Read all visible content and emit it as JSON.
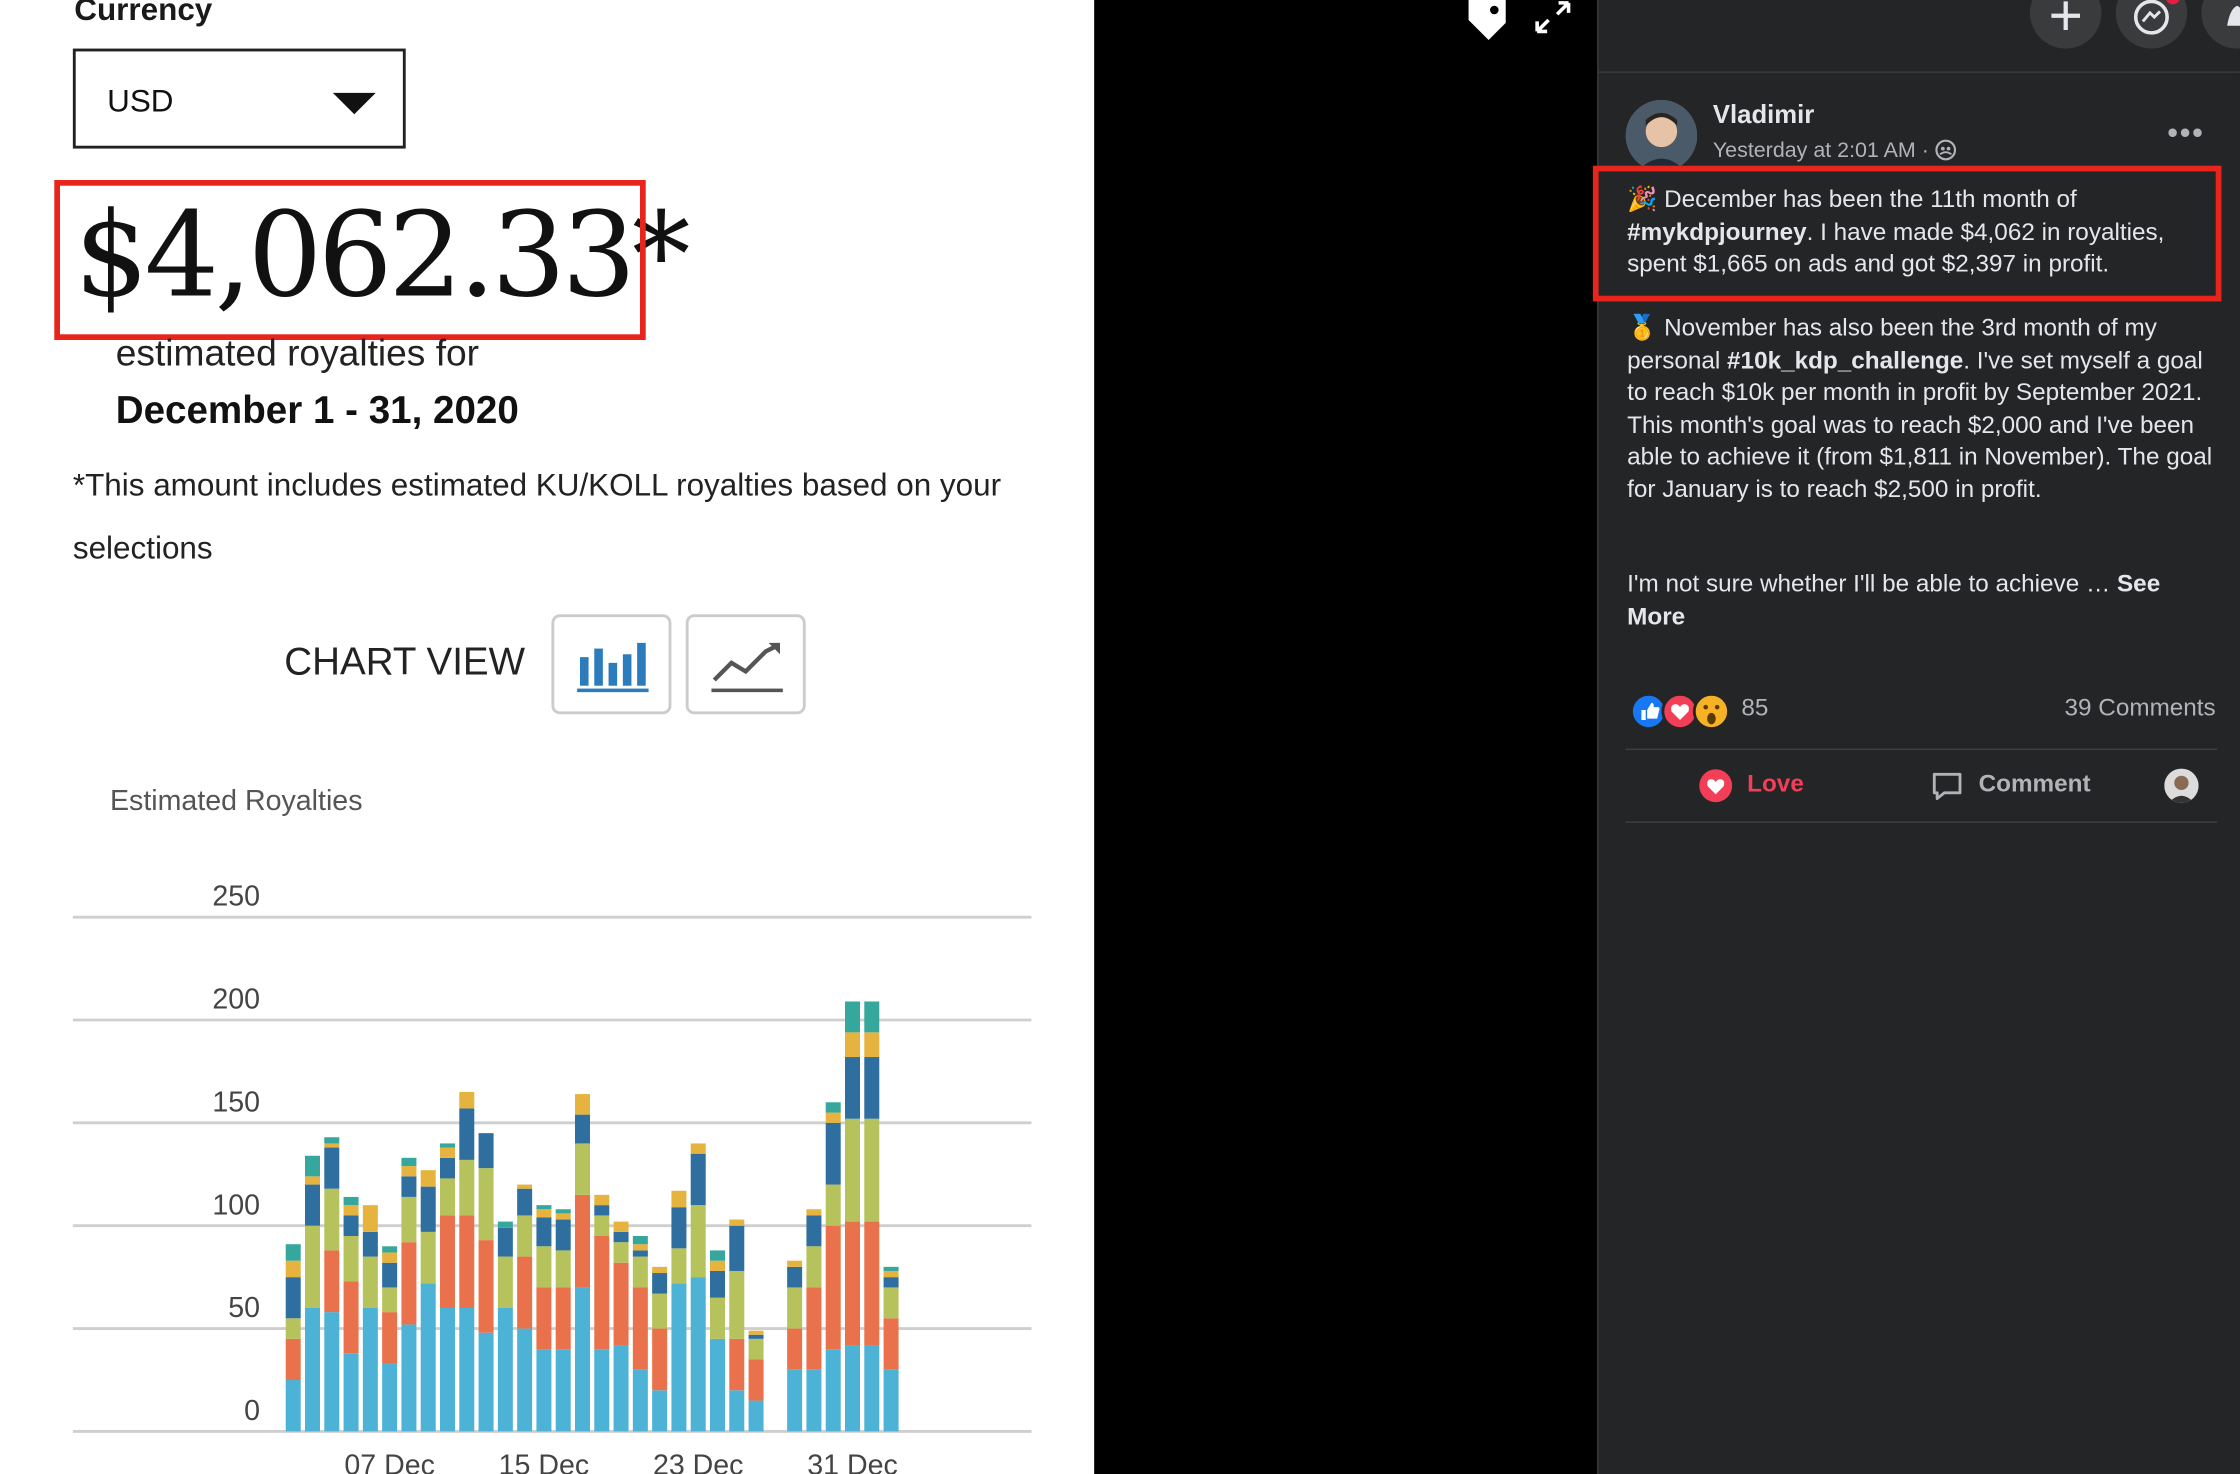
{
  "left": {
    "currency_label": "Currency",
    "currency_value": "USD",
    "amount": "$4,062.33*",
    "est_line1": "estimated royalties for",
    "est_range": "December 1 - 31, 2020",
    "note": "*This amount includes estimated KU/KOLL royalties based on your selections",
    "chart_view_label": "CHART VIEW",
    "chart_title": "Estimated Royalties"
  },
  "chart_data": {
    "type": "bar",
    "stacked": true,
    "title": "Estimated Royalties",
    "ylim": [
      0,
      250
    ],
    "yticks": [
      0,
      50,
      100,
      150,
      200,
      250
    ],
    "xtick_labels": [
      "07 Dec",
      "15 Dec",
      "23 Dec",
      "31 Dec"
    ],
    "xtick_index": [
      5,
      13,
      21,
      29
    ],
    "categories": [
      "01 Dec",
      "02 Dec",
      "03 Dec",
      "04 Dec",
      "05 Dec",
      "06 Dec",
      "07 Dec",
      "08 Dec",
      "09 Dec",
      "10 Dec",
      "11 Dec",
      "12 Dec",
      "13 Dec",
      "14 Dec",
      "15 Dec",
      "16 Dec",
      "17 Dec",
      "18 Dec",
      "19 Dec",
      "20 Dec",
      "21 Dec",
      "22 Dec",
      "23 Dec",
      "24 Dec",
      "25 Dec",
      "26 Dec",
      "27 Dec",
      "28 Dec",
      "29 Dec",
      "30 Dec",
      "31 Dec",
      "01 Jan"
    ],
    "colors": [
      "#4db3d6",
      "#e9724c",
      "#b6c25b",
      "#2f6f9f",
      "#e6b33f",
      "#35a79c",
      "#f08c8c"
    ],
    "series": [
      {
        "values": [
          25,
          60,
          58,
          38,
          60,
          33,
          52,
          72,
          60,
          60,
          48,
          60,
          50,
          40,
          40,
          70,
          40,
          42,
          30,
          20,
          72,
          75,
          45,
          20,
          15,
          0,
          30,
          30,
          40,
          42,
          42,
          30
        ]
      },
      {
        "values": [
          20,
          0,
          30,
          35,
          0,
          25,
          40,
          0,
          45,
          45,
          45,
          0,
          35,
          30,
          30,
          45,
          55,
          40,
          40,
          30,
          0,
          0,
          0,
          25,
          20,
          0,
          20,
          40,
          60,
          60,
          60,
          25
        ]
      },
      {
        "values": [
          10,
          40,
          30,
          22,
          25,
          12,
          22,
          25,
          18,
          27,
          35,
          25,
          20,
          20,
          18,
          25,
          10,
          10,
          15,
          17,
          17,
          35,
          20,
          33,
          10,
          0,
          20,
          20,
          20,
          50,
          50,
          15
        ]
      },
      {
        "values": [
          20,
          20,
          20,
          10,
          12,
          12,
          10,
          22,
          10,
          25,
          17,
          14,
          13,
          14,
          15,
          14,
          5,
          5,
          3,
          10,
          20,
          25,
          13,
          22,
          2,
          0,
          10,
          15,
          30,
          30,
          30,
          5
        ]
      },
      {
        "values": [
          8,
          4,
          2,
          5,
          13,
          5,
          5,
          8,
          5,
          8,
          0,
          0,
          2,
          4,
          3,
          10,
          5,
          5,
          3,
          3,
          8,
          5,
          5,
          3,
          2,
          0,
          3,
          3,
          5,
          12,
          12,
          3
        ]
      },
      {
        "values": [
          8,
          10,
          3,
          4,
          0,
          3,
          4,
          0,
          2,
          0,
          0,
          3,
          0,
          2,
          2,
          0,
          0,
          0,
          4,
          0,
          0,
          0,
          5,
          0,
          0,
          0,
          0,
          0,
          5,
          15,
          15,
          2
        ]
      },
      {
        "values": [
          0,
          0,
          0,
          0,
          0,
          0,
          0,
          0,
          0,
          0,
          0,
          0,
          0,
          0,
          0,
          0,
          0,
          0,
          0,
          0,
          0,
          0,
          0,
          0,
          0,
          0,
          0,
          0,
          0,
          0,
          0,
          0
        ]
      }
    ]
  },
  "right": {
    "author": "Vladimir",
    "time": "Yesterday at 2:01 AM ·",
    "p1_pre": "🎉 December has been the 11th month of ",
    "p1_tag": "#mykdpjourney",
    "p1_post": ". I have made $4,062 in royalties, spent $1,665 on ads and got $2,397 in profit.",
    "p2_pre": "🥇 November has also been the 3rd month of my personal ",
    "p2_tag": "#10k_kdp_challenge",
    "p2_post": ". I've set myself a goal to reach $10k per month in profit by September 2021. This month's goal was to reach $2,000 and I've been able to achieve it (from $1,811 in November). The goal for January is to reach $2,500 in profit.",
    "p3": "I'm not sure whether I'll be able to achieve … ",
    "see_more": "See More",
    "reaction_count": "85",
    "comments_count": "39 Comments",
    "love_label": "Love",
    "comment_label": "Comment"
  }
}
